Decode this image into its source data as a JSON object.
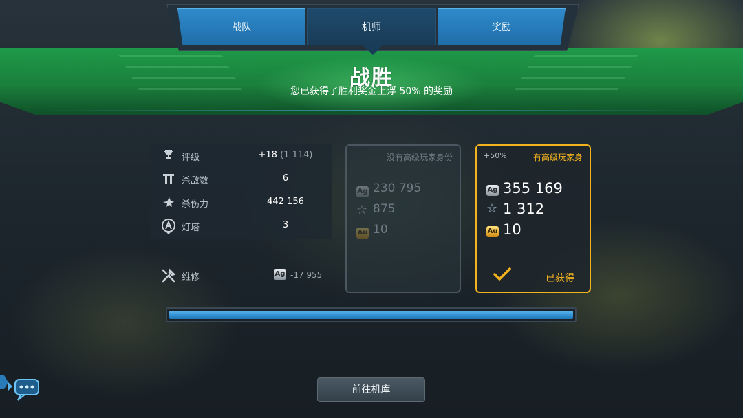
{
  "tabs": [
    {
      "label": "战队",
      "active": false
    },
    {
      "label": "机师",
      "active": true
    },
    {
      "label": "奖励",
      "active": false
    }
  ],
  "header": {
    "title": "战胜",
    "subtitle": "您已获得了胜利奖金上浮 50% 的奖励"
  },
  "stats": [
    {
      "icon": "trophy-icon",
      "label": "评级",
      "value": "+18",
      "sub": "(1 114)"
    },
    {
      "icon": "kills-icon",
      "label": "杀敌数",
      "value": "6",
      "sub": ""
    },
    {
      "icon": "damage-icon",
      "label": "杀伤力",
      "value": "442 156",
      "sub": ""
    },
    {
      "icon": "beacon-icon",
      "label": "灯塔",
      "value": "3",
      "sub": ""
    }
  ],
  "repair": {
    "label": "维修",
    "currency": "Ag",
    "value": "-17 955"
  },
  "free_card": {
    "header": "没有高级玩家身份",
    "rewards": {
      "silver": "230 795",
      "xp": "875",
      "gold": "10"
    }
  },
  "premium_card": {
    "bonus": "+50%",
    "header": "有高级玩家身",
    "rewards": {
      "silver": "355 169",
      "xp": "1 312",
      "gold": "10"
    },
    "status": "已获得"
  },
  "currency_labels": {
    "silver": "Ag",
    "gold": "Au"
  },
  "progress": {
    "fraction": 1.0
  },
  "buttons": {
    "go_hangar": "前往机库"
  },
  "colors": {
    "accent_gold": "#f2b31f",
    "victory_green": "#1f9a49",
    "tab_blue": "#2f8acb"
  }
}
